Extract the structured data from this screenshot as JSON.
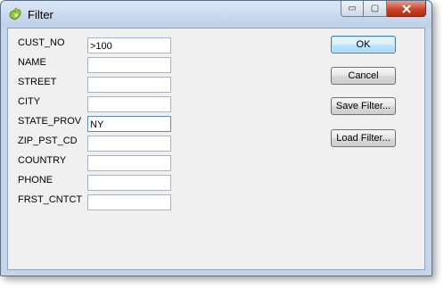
{
  "window": {
    "title": "Filter",
    "caption_buttons": {
      "minimize": "▭",
      "maximize": "▢",
      "close": "✕"
    }
  },
  "fields": [
    {
      "label": "CUST_NO",
      "value": ">100"
    },
    {
      "label": "NAME",
      "value": ""
    },
    {
      "label": "STREET",
      "value": ""
    },
    {
      "label": "CITY",
      "value": ""
    },
    {
      "label": "STATE_PROV",
      "value": "NY"
    },
    {
      "label": "ZIP_PST_CD",
      "value": ""
    },
    {
      "label": "COUNTRY",
      "value": ""
    },
    {
      "label": "PHONE",
      "value": ""
    },
    {
      "label": "FRST_CNTCT",
      "value": ""
    }
  ],
  "buttons": {
    "ok": "OK",
    "cancel": "Cancel",
    "save_filter": "Save Filter...",
    "load_filter": "Load Filter..."
  },
  "icons": {
    "app": "filter-app-icon"
  },
  "colors": {
    "titlebar": "#c6d6e8",
    "close": "#c9452c",
    "client": "#f0f0f0"
  }
}
